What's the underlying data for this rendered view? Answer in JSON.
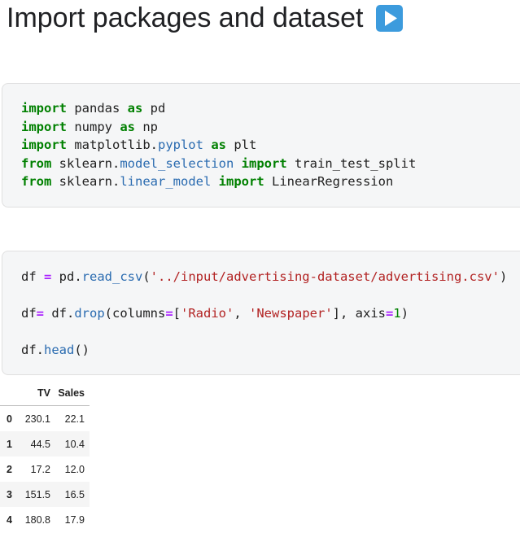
{
  "heading": {
    "title": "Import packages and dataset",
    "icon": "play-button-icon",
    "icon_color": "#3c9bdd"
  },
  "cell_1": {
    "lines": [
      [
        "import",
        " pandas ",
        "as",
        " pd"
      ],
      [
        "import",
        " numpy ",
        "as",
        " np"
      ],
      [
        "import",
        " matplotlib.",
        "pyplot",
        " ",
        "as",
        " plt"
      ],
      [
        "from",
        " sklearn.",
        "model_selection",
        " ",
        "import",
        " train_test_split"
      ],
      [
        "from",
        " sklearn.",
        "linear_model",
        " ",
        "import",
        " LinearRegression"
      ]
    ]
  },
  "cell_2": {
    "line1": {
      "a": "df ",
      "b": "=",
      "c": " pd.",
      "d": "read_csv",
      "e": "(",
      "f": "'../input/advertising-dataset/advertising.csv'",
      "g": ")"
    },
    "line2": {
      "a": "df",
      "b": "=",
      "c": " df.",
      "d": "drop",
      "e": "(columns",
      "f": "=",
      "g": "[",
      "h": "'Radio'",
      "i": ", ",
      "j": "'Newspaper'",
      "k": "], axis",
      "l": "=",
      "m": "1",
      "n": ")"
    },
    "line3": {
      "a": "df.",
      "b": "head",
      "c": "()"
    }
  },
  "table": {
    "columns": [
      "TV",
      "Sales"
    ],
    "rows": [
      {
        "index": "0",
        "tv": "230.1",
        "sales": "22.1"
      },
      {
        "index": "1",
        "tv": "44.5",
        "sales": "10.4"
      },
      {
        "index": "2",
        "tv": "17.2",
        "sales": "12.0"
      },
      {
        "index": "3",
        "tv": "151.5",
        "sales": "16.5"
      },
      {
        "index": "4",
        "tv": "180.8",
        "sales": "17.9"
      }
    ]
  }
}
